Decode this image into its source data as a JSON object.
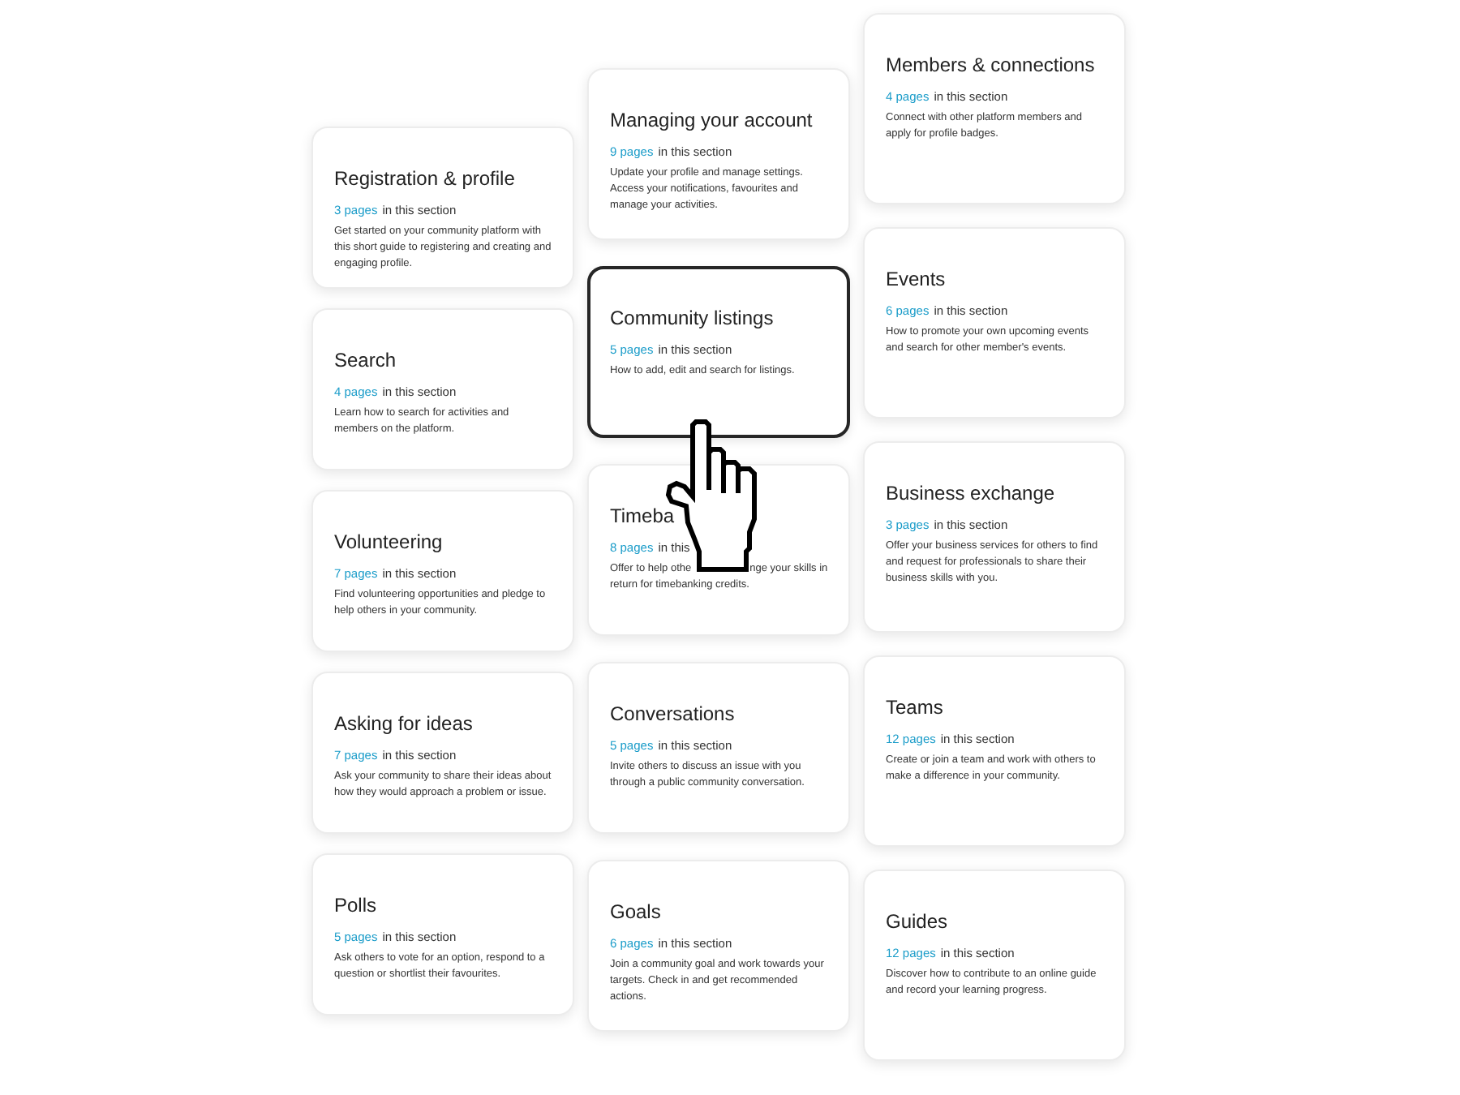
{
  "sections": [
    {
      "kind": "card",
      "title": "Registration & profile",
      "count": "3 pages",
      "count_suffix": "in this section",
      "description": "Get started on your community platform with this short guide to registering and creating and engaging profile.",
      "selected": false
    },
    {
      "kind": "card",
      "title": "Managing your account",
      "count": "9 pages",
      "count_suffix": "in this section",
      "description": "Update your profile and manage settings. Access your notifications, favourites and manage your activities.",
      "selected": false
    },
    {
      "kind": "card",
      "title": "Members & connections",
      "count": "4 pages",
      "count_suffix": "in this section",
      "description": "Connect with other platform members and apply for profile badges.",
      "selected": false
    },
    {
      "kind": "card",
      "title": "Search",
      "count": "4 pages",
      "count_suffix": "in this section",
      "description": "Learn how to search for activities and members on the platform.",
      "selected": false
    },
    {
      "kind": "card",
      "title": "Community listings",
      "count": "5 pages",
      "count_suffix": "in this section",
      "description": "How to add, edit and search for listings.",
      "selected": true
    },
    {
      "kind": "card",
      "title": "Events",
      "count": "6 pages",
      "count_suffix": "in this section",
      "description": "How to promote your own upcoming events and search for other member's events.",
      "selected": false
    },
    {
      "kind": "card",
      "title": "Volunteering",
      "count": "7 pages",
      "count_suffix": "in this section",
      "description": "Find volunteering opportunities and pledge to help others in your community.",
      "selected": false
    },
    {
      "kind": "covered",
      "title": "Timeba",
      "count": "8 pages",
      "count_suffix": "in this",
      "description_rows": [
        [
          "Offer to help othe",
          "nge your skills in"
        ],
        [
          "return for timebanking credits."
        ]
      ],
      "selected": false
    },
    {
      "kind": "card",
      "title": "Business exchange",
      "count": "3 pages",
      "count_suffix": "in this section",
      "description": "Offer your business services for others to find and request for professionals to share their business skills with you.",
      "selected": false
    },
    {
      "kind": "card",
      "title": "Asking for ideas",
      "count": "7 pages",
      "count_suffix": "in this section",
      "description": "Ask your community to share their ideas about how they would approach a problem or issue.",
      "selected": false
    },
    {
      "kind": "card",
      "title": "Conversations",
      "count": "5 pages",
      "count_suffix": "in this section",
      "description": "Invite others to discuss an issue with you through a public community conversation.",
      "selected": false
    },
    {
      "kind": "card",
      "title": "Teams",
      "count": "12 pages",
      "count_suffix": "in this section",
      "description": "Create or join a team and work with others to make a difference in your community.",
      "selected": false
    },
    {
      "kind": "card",
      "title": "Polls",
      "count": "5 pages",
      "count_suffix": "in this section",
      "description": "Ask others to vote for an option, respond to a question or shortlist their favourites.",
      "selected": false
    },
    {
      "kind": "card",
      "title": "Goals",
      "count": "6 pages",
      "count_suffix": "in this section",
      "description": "Join a community goal and work towards your targets. Check in and get recommended actions.",
      "selected": false
    },
    {
      "kind": "card",
      "title": "Guides",
      "count": "12 pages",
      "count_suffix": "in this section",
      "description": "Discover how to contribute to an online guide and record your learning progress.",
      "selected": false
    }
  ]
}
